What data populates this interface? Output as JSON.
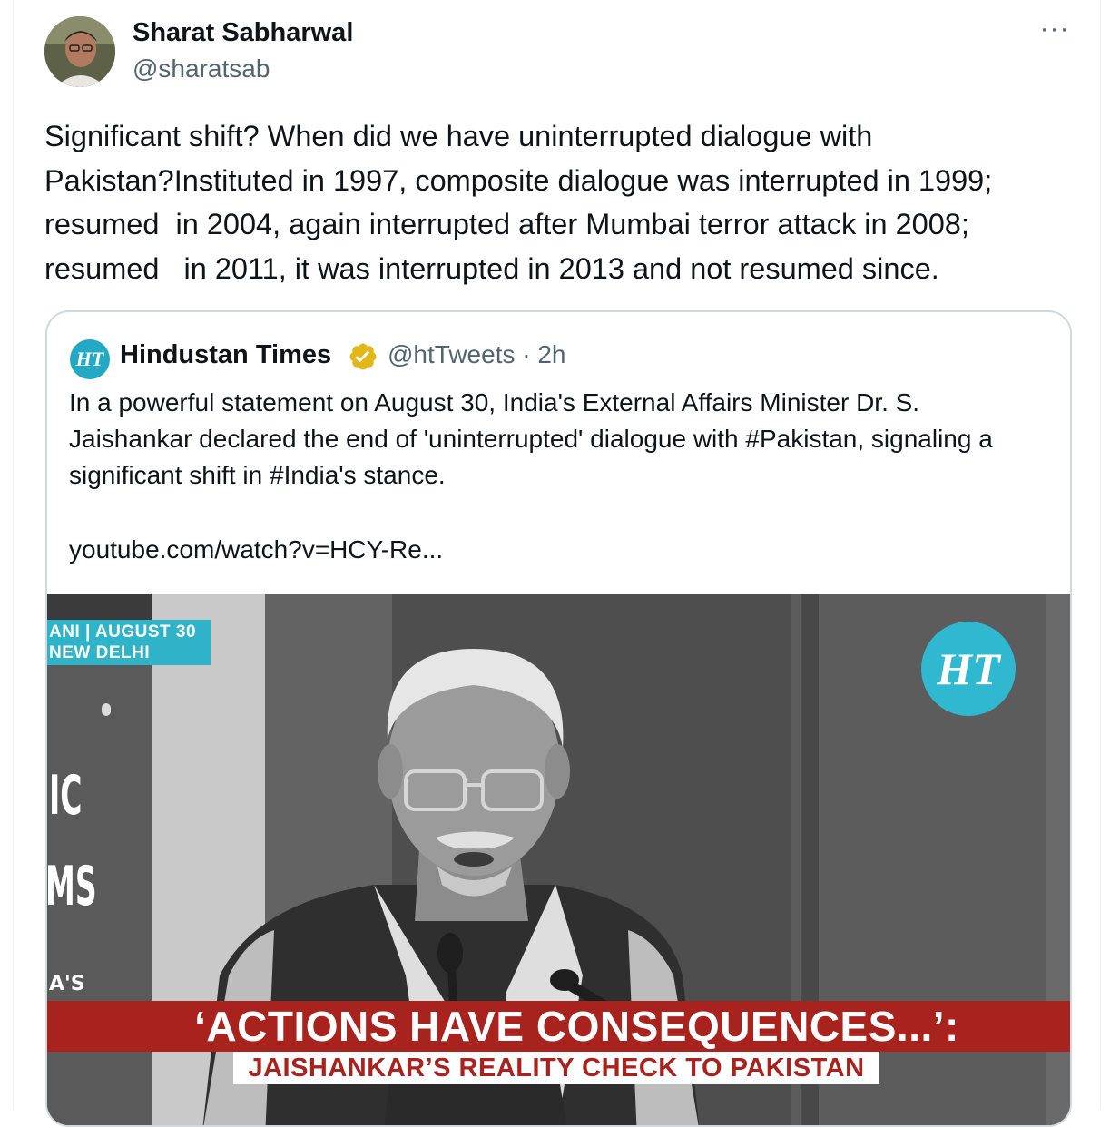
{
  "author": {
    "name": "Sharat Sabharwal",
    "handle": "@sharatsab"
  },
  "more_icon": "more-horizontal-icon",
  "more_label": "···",
  "tweet": {
    "text": "Significant shift? When did we have uninterrupted dialogue with\nPakistan?Instituted in 1997, composite dialogue was interrupted in 1999;\nresumed  in 2004, again interrupted after Mumbai terror attack in 2008;\nresumed   in 2011, it was interrupted in 2013 and not resumed since."
  },
  "quoted": {
    "logo_text": "HT",
    "name": "Hindustan Times",
    "verified_icon": "gold-verified-badge-icon",
    "meta": "@htTweets · 2h",
    "text": "In a powerful statement on August 30, India's External Affairs Minister Dr. S. Jaishankar declared the end of 'uninterrupted' dialogue with #Pakistan, signaling a significant shift in #India's stance.",
    "link": "youtube.com/watch?v=HCY-Re...",
    "video": {
      "tag_line1": "ANI | AUGUST 30",
      "tag_line2": "NEW DELHI",
      "badge": "HT",
      "side_letters_1": "IC",
      "side_letters_2": "MS",
      "side_letters_3": "A'S",
      "banner": "‘ACTIONS HAVE CONSEQUENCES...’:",
      "sub_banner": "JAISHANKAR’S REALITY CHECK TO PAKISTAN",
      "colors": {
        "tag": "#2fb3c9",
        "banner": "#a8231e",
        "badge": "#2fb8d0"
      }
    }
  },
  "colors": {
    "text": "#0f1419",
    "secondary": "#536471",
    "border": "#cfd9de"
  }
}
